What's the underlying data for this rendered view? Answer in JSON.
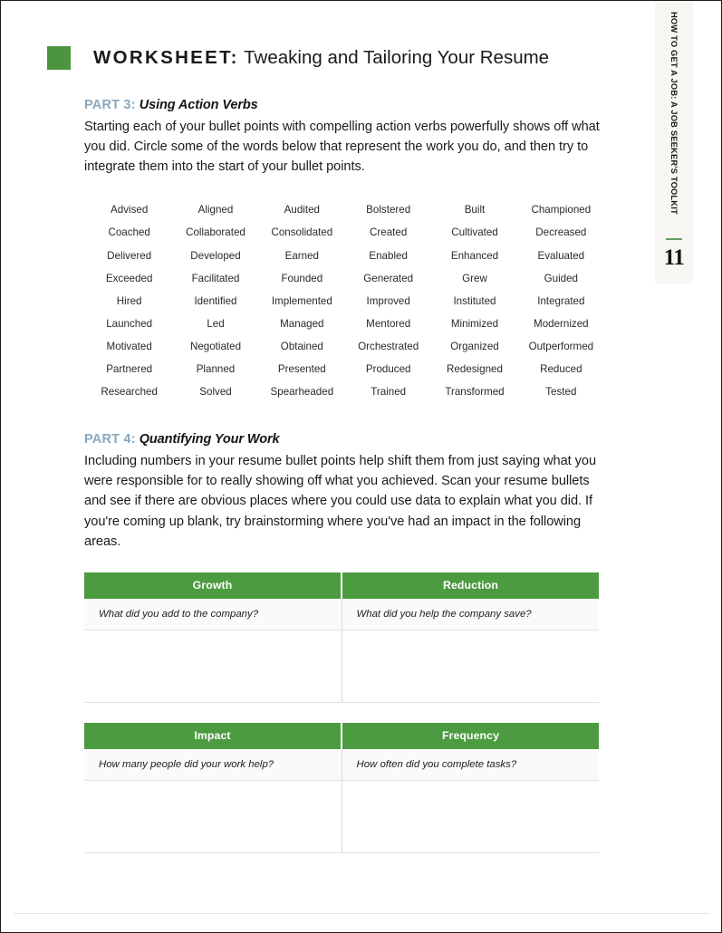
{
  "side_tab": {
    "book_title": "HOW TO GET A JOB: A JOB SEEKER'S TOOLKIT",
    "page_number": "11"
  },
  "header": {
    "worksheet_label": "WORKSHEET:",
    "worksheet_title": "Tweaking and Tailoring Your Resume"
  },
  "part3": {
    "number": "PART 3:",
    "title": "Using Action Verbs",
    "body": "Starting each of your bullet points with compelling action verbs powerfully shows off what you did. Circle some of the words below that represent the work you do, and then try to integrate them into the start of your bullet points.",
    "verbs": [
      "Advised",
      "Aligned",
      "Audited",
      "Bolstered",
      "Built",
      "Championed",
      "Coached",
      "Collaborated",
      "Consolidated",
      "Created",
      "Cultivated",
      "Decreased",
      "Delivered",
      "Developed",
      "Earned",
      "Enabled",
      "Enhanced",
      "Evaluated",
      "Exceeded",
      "Facilitated",
      "Founded",
      "Generated",
      "Grew",
      "Guided",
      "Hired",
      "Identified",
      "Implemented",
      "Improved",
      "Instituted",
      "Integrated",
      "Launched",
      "Led",
      "Managed",
      "Mentored",
      "Minimized",
      "Modernized",
      "Motivated",
      "Negotiated",
      "Obtained",
      "Orchestrated",
      "Organized",
      "Outperformed",
      "Partnered",
      "Planned",
      "Presented",
      "Produced",
      "Redesigned",
      "Reduced",
      "Researched",
      "Solved",
      "Spearheaded",
      "Trained",
      "Transformed",
      "Tested"
    ]
  },
  "part4": {
    "number": "PART 4:",
    "title": "Quantifying Your Work",
    "body": "Including numbers in your resume bullet points help shift them from just saying what you were responsible for to really showing off what you achieved. Scan your resume bullets and see if there are obvious places where you could use data to explain what you did. If you're coming up blank, try brainstorming where you've had an impact in the following areas.",
    "tables": [
      {
        "headers": [
          "Growth",
          "Reduction"
        ],
        "prompts": [
          "What did you add to the company?",
          "What did you help the company save?"
        ]
      },
      {
        "headers": [
          "Impact",
          "Frequency"
        ],
        "prompts": [
          "How many people did your work help?",
          "How often did you complete tasks?"
        ]
      }
    ]
  },
  "colors": {
    "green": "#4d9b41",
    "part_label_blue": "#8aa7bd",
    "tab_rule_green": "#6a9b63"
  }
}
